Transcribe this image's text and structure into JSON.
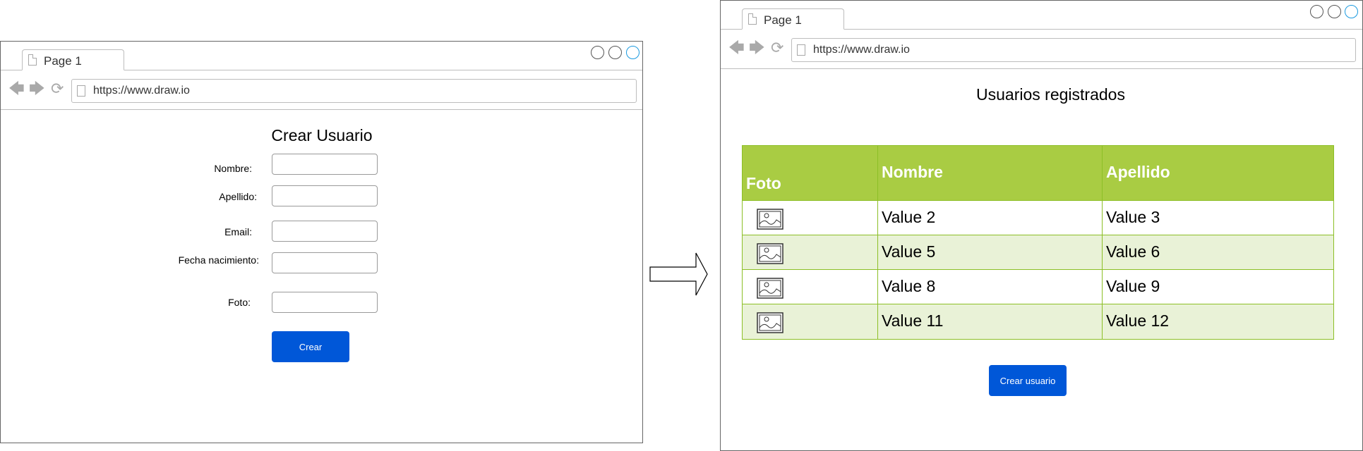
{
  "left_browser": {
    "tab_label": "Page 1",
    "url": "https://www.draw.io",
    "form": {
      "title": "Crear Usuario",
      "fields": [
        {
          "label": "Nombre:"
        },
        {
          "label": "Apellido:"
        },
        {
          "label": "Email:"
        },
        {
          "label": "Fecha nacimiento:"
        },
        {
          "label": "Foto:"
        }
      ],
      "submit_label": "Crear"
    }
  },
  "right_browser": {
    "tab_label": "Page 1",
    "url": "https://www.draw.io",
    "title": "Usuarios registrados",
    "table": {
      "headers": [
        "Foto",
        "Nombre",
        "Apellido"
      ],
      "rows": [
        {
          "photo_icon": "image-icon",
          "nombre": "Value 2",
          "apellido": "Value 3"
        },
        {
          "photo_icon": "image-icon",
          "nombre": "Value 5",
          "apellido": "Value 6"
        },
        {
          "photo_icon": "image-icon",
          "nombre": "Value 8",
          "apellido": "Value 9"
        },
        {
          "photo_icon": "image-icon",
          "nombre": "Value 11",
          "apellido": "Value 12"
        }
      ]
    },
    "button_label": "Crear usuario"
  },
  "colors": {
    "button_blue": "#0057d8",
    "table_header_green": "#a9cc43",
    "table_alt_row": "#e9f2d7",
    "table_border": "#8cbf26",
    "window_button_accent": "#1a9ae0"
  },
  "icons": [
    "page-icon",
    "back-arrow-icon",
    "forward-arrow-icon",
    "reload-icon",
    "image-icon",
    "flow-arrow-icon"
  ]
}
